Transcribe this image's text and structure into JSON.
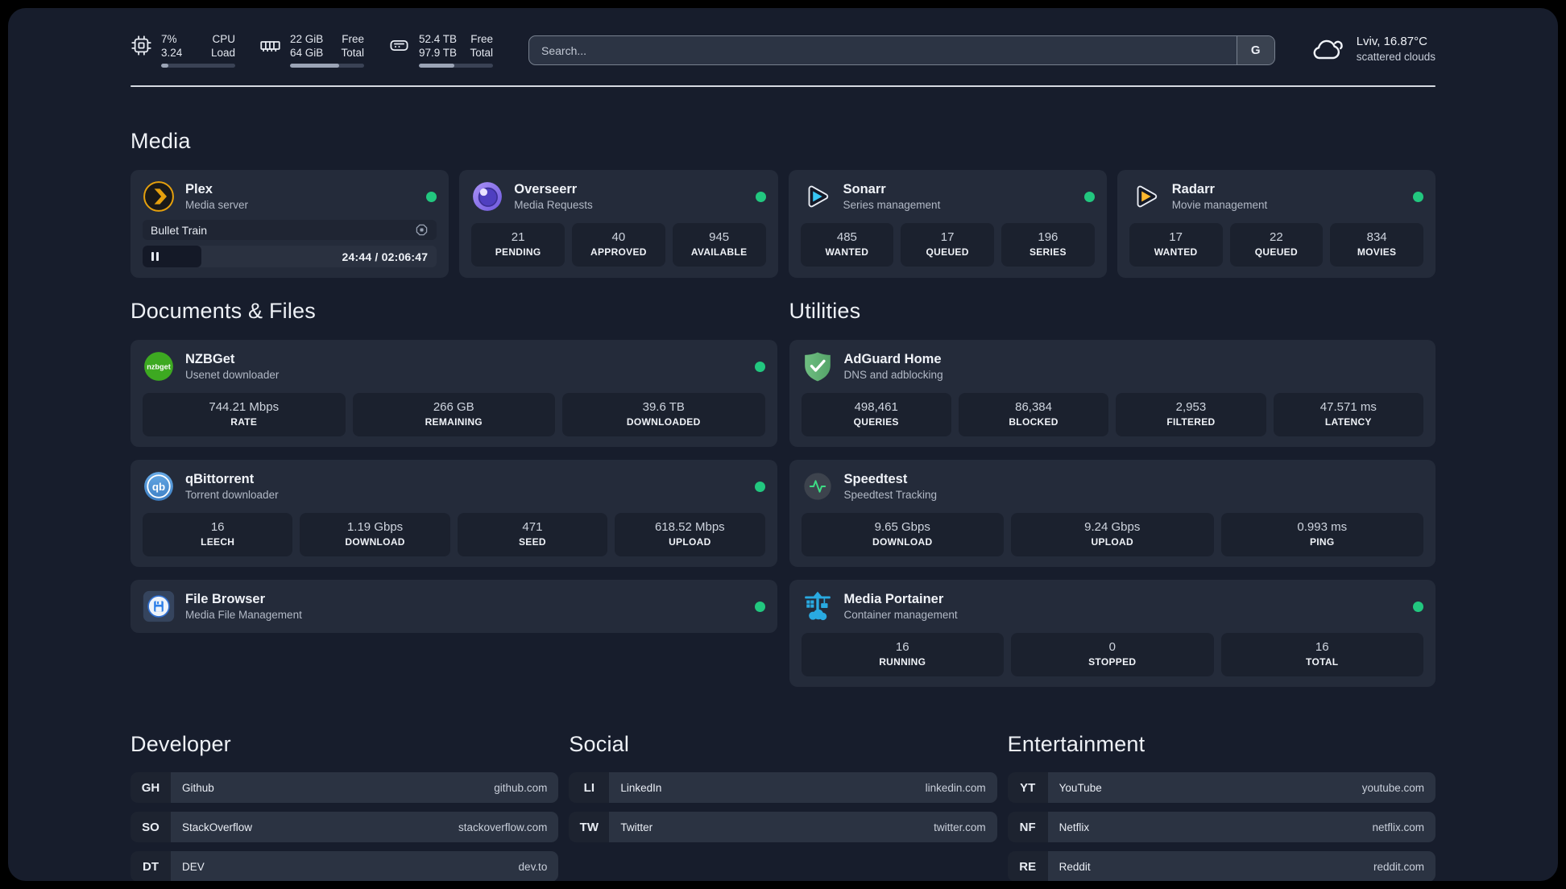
{
  "header": {
    "cpu": {
      "values": [
        "7%",
        "3.24"
      ],
      "labels": [
        "CPU",
        "Load"
      ],
      "progress_pct": 10
    },
    "memory": {
      "values": [
        "22 GiB",
        "64 GiB"
      ],
      "labels": [
        "Free",
        "Total"
      ],
      "progress_pct": 66
    },
    "storage": {
      "values": [
        "52.4 TB",
        "97.9 TB"
      ],
      "labels": [
        "Free",
        "Total"
      ],
      "progress_pct": 48
    },
    "search": {
      "placeholder": "Search...",
      "provider": "G"
    },
    "weather": {
      "line1": "Lviv, 16.87°C",
      "line2": "scattered clouds"
    }
  },
  "media": {
    "title": "Media",
    "plex": {
      "name": "Plex",
      "desc": "Media server",
      "status": "online",
      "now_playing": "Bullet Train",
      "time": "24:44 / 02:06:47",
      "progress_pct": 20
    },
    "overseerr": {
      "name": "Overseerr",
      "desc": "Media Requests",
      "status": "online",
      "stats": [
        {
          "value": "21",
          "label": "PENDING"
        },
        {
          "value": "40",
          "label": "APPROVED"
        },
        {
          "value": "945",
          "label": "AVAILABLE"
        }
      ]
    },
    "sonarr": {
      "name": "Sonarr",
      "desc": "Series management",
      "status": "online",
      "stats": [
        {
          "value": "485",
          "label": "WANTED"
        },
        {
          "value": "17",
          "label": "QUEUED"
        },
        {
          "value": "196",
          "label": "SERIES"
        }
      ]
    },
    "radarr": {
      "name": "Radarr",
      "desc": "Movie management",
      "status": "online",
      "stats": [
        {
          "value": "17",
          "label": "WANTED"
        },
        {
          "value": "22",
          "label": "QUEUED"
        },
        {
          "value": "834",
          "label": "MOVIES"
        }
      ]
    }
  },
  "documents": {
    "title": "Documents & Files",
    "nzbget": {
      "name": "NZBGet",
      "desc": "Usenet downloader",
      "status": "online",
      "stats": [
        {
          "value": "744.21 Mbps",
          "label": "RATE"
        },
        {
          "value": "266 GB",
          "label": "REMAINING"
        },
        {
          "value": "39.6 TB",
          "label": "DOWNLOADED"
        }
      ]
    },
    "qbittorrent": {
      "name": "qBittorrent",
      "desc": "Torrent downloader",
      "status": "online",
      "stats": [
        {
          "value": "16",
          "label": "LEECH"
        },
        {
          "value": "1.19 Gbps",
          "label": "DOWNLOAD"
        },
        {
          "value": "471",
          "label": "SEED"
        },
        {
          "value": "618.52 Mbps",
          "label": "UPLOAD"
        }
      ]
    },
    "filebrowser": {
      "name": "File Browser",
      "desc": "Media File Management",
      "status": "online"
    }
  },
  "utilities": {
    "title": "Utilities",
    "adguard": {
      "name": "AdGuard Home",
      "desc": "DNS and adblocking",
      "stats": [
        {
          "value": "498,461",
          "label": "QUERIES"
        },
        {
          "value": "86,384",
          "label": "BLOCKED"
        },
        {
          "value": "2,953",
          "label": "FILTERED"
        },
        {
          "value": "47.571 ms",
          "label": "LATENCY"
        }
      ]
    },
    "speedtest": {
      "name": "Speedtest",
      "desc": "Speedtest Tracking",
      "stats": [
        {
          "value": "9.65 Gbps",
          "label": "DOWNLOAD"
        },
        {
          "value": "9.24 Gbps",
          "label": "UPLOAD"
        },
        {
          "value": "0.993 ms",
          "label": "PING"
        }
      ]
    },
    "portainer": {
      "name": "Media Portainer",
      "desc": "Container management",
      "status": "online",
      "stats": [
        {
          "value": "16",
          "label": "RUNNING"
        },
        {
          "value": "0",
          "label": "STOPPED"
        },
        {
          "value": "16",
          "label": "TOTAL"
        }
      ]
    }
  },
  "links": {
    "developer": {
      "title": "Developer",
      "items": [
        {
          "abbr": "GH",
          "name": "Github",
          "url": "github.com"
        },
        {
          "abbr": "SO",
          "name": "StackOverflow",
          "url": "stackoverflow.com"
        },
        {
          "abbr": "DT",
          "name": "DEV",
          "url": "dev.to"
        }
      ]
    },
    "social": {
      "title": "Social",
      "items": [
        {
          "abbr": "LI",
          "name": "LinkedIn",
          "url": "linkedin.com"
        },
        {
          "abbr": "TW",
          "name": "Twitter",
          "url": "twitter.com"
        }
      ]
    },
    "entertainment": {
      "title": "Entertainment",
      "items": [
        {
          "abbr": "YT",
          "name": "YouTube",
          "url": "youtube.com"
        },
        {
          "abbr": "NF",
          "name": "Netflix",
          "url": "netflix.com"
        },
        {
          "abbr": "RE",
          "name": "Reddit",
          "url": "reddit.com"
        }
      ]
    }
  },
  "colors": {
    "status_online": "#22c77f",
    "plex_orange": "#e5a00d",
    "sonarr_blue": "#38c6f4",
    "radarr_yellow": "#ffb92e",
    "adguard_green": "#67b37a",
    "portainer_blue": "#29aae1",
    "nzbget_green": "#3da921",
    "speedtest_green": "#3ddc84"
  }
}
